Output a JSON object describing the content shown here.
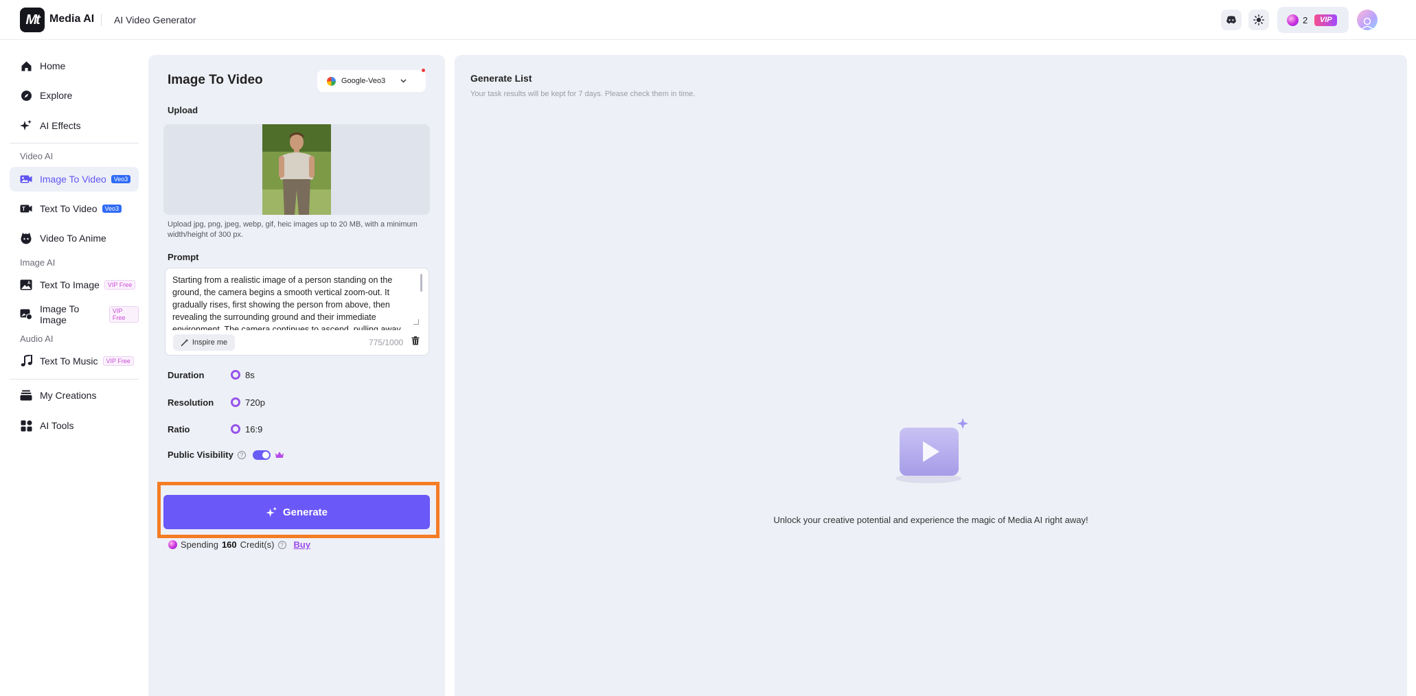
{
  "header": {
    "brand": "Media AI",
    "logo_text": "Mt",
    "title": "AI Video Generator",
    "credits": "2",
    "vip_label": "VIP"
  },
  "sidebar": {
    "items_top": [
      {
        "label": "Home",
        "icon": "home-icon"
      },
      {
        "label": "Explore",
        "icon": "compass-icon"
      },
      {
        "label": "AI Effects",
        "icon": "sparkles-icon"
      }
    ],
    "video_section": "Video AI",
    "video_items": [
      {
        "label": "Image To Video",
        "tag": "Veo3",
        "active": true
      },
      {
        "label": "Text To Video",
        "tag": "Veo3"
      },
      {
        "label": "Video To Anime"
      }
    ],
    "image_section": "Image AI",
    "image_items": [
      {
        "label": "Text To Image",
        "tag": "VIP Free"
      },
      {
        "label": "Image To Image",
        "tag": "VIP Free"
      }
    ],
    "audio_section": "Audio AI",
    "audio_items": [
      {
        "label": "Text To Music",
        "tag": "VIP Free"
      }
    ],
    "items_bottom": [
      {
        "label": "My Creations"
      },
      {
        "label": "AI Tools"
      }
    ]
  },
  "form": {
    "title": "Image To Video",
    "model": "Google-Veo3",
    "upload_label": "Upload",
    "upload_hint": "Upload jpg, png, jpeg, webp, gif, heic images up to 20 MB, with a minimum width/height of 300 px.",
    "prompt_label": "Prompt",
    "prompt_text": "Starting from a realistic image of a person standing on the ground, the camera begins a smooth vertical zoom-out. It gradually rises, first showing the person from above, then revealing the surrounding ground and their immediate environment. The camera continues to ascend, pulling away",
    "inspire_label": "Inspire me",
    "counter": "775/1000",
    "duration_label": "Duration",
    "duration_value": "8s",
    "resolution_label": "Resolution",
    "resolution_value": "720p",
    "ratio_label": "Ratio",
    "ratio_value": "16:9",
    "visibility_label": "Public Visibility",
    "visibility_on": true,
    "generate_label": "Generate",
    "spend_prefix": "Spending",
    "spend_amount": "160",
    "spend_suffix": "Credit(s)",
    "buy_label": "Buy"
  },
  "list": {
    "title": "Generate List",
    "subtitle": "Your task results will be kept for 7 days. Please check them in time.",
    "empty_text": "Unlock your creative potential and experience the magic of Media AI right away!"
  },
  "colors": {
    "accent": "#6a58f9",
    "highlight": "#f47c24",
    "panel_bg": "#eef0f7",
    "vip_pink": "#c84cd7",
    "veo_blue": "#2f6bf6"
  }
}
